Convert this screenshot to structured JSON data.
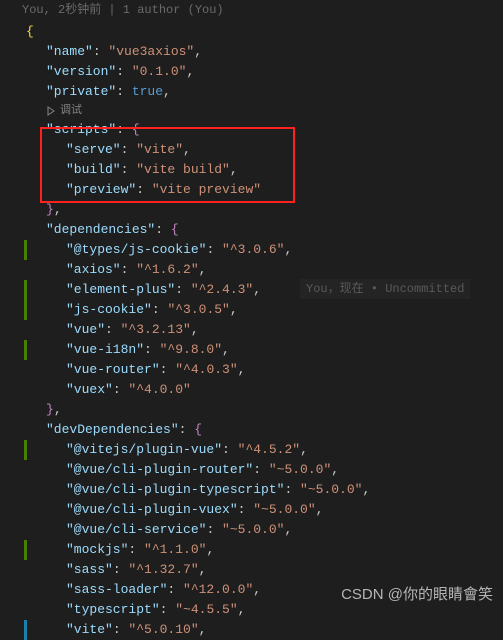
{
  "blame_top": "You, 2秒钟前 | 1 author (You)",
  "codelens_debug": "调试",
  "inline_blame": "You，现在 • Uncommitted",
  "watermark": "CSDN @你的眼睛會笑",
  "json": {
    "name_key": "\"name\"",
    "name_val": "\"vue3axios\"",
    "version_key": "\"version\"",
    "version_val": "\"0.1.0\"",
    "private_key": "\"private\"",
    "private_val": "true",
    "scripts_key": "\"scripts\"",
    "scripts": {
      "serve_key": "\"serve\"",
      "serve_val": "\"vite\"",
      "build_key": "\"build\"",
      "build_val": "\"vite build\"",
      "preview_key": "\"preview\"",
      "preview_val": "\"vite preview\""
    },
    "dependencies_key": "\"dependencies\"",
    "deps": {
      "types_jscookie_key": "\"@types/js-cookie\"",
      "types_jscookie_val": "\"^3.0.6\"",
      "axios_key": "\"axios\"",
      "axios_val": "\"^1.6.2\"",
      "element_plus_key": "\"element-plus\"",
      "element_plus_val": "\"^2.4.3\"",
      "js_cookie_key": "\"js-cookie\"",
      "js_cookie_val": "\"^3.0.5\"",
      "vue_key": "\"vue\"",
      "vue_val": "\"^3.2.13\"",
      "vue_i18n_key": "\"vue-i18n\"",
      "vue_i18n_val": "\"^9.8.0\"",
      "vue_router_key": "\"vue-router\"",
      "vue_router_val": "\"^4.0.3\"",
      "vuex_key": "\"vuex\"",
      "vuex_val": "\"^4.0.0\""
    },
    "devDependencies_key": "\"devDependencies\"",
    "devdeps": {
      "vitejs_plugin_vue_key": "\"@vitejs/plugin-vue\"",
      "vitejs_plugin_vue_val": "\"^4.5.2\"",
      "cli_router_key": "\"@vue/cli-plugin-router\"",
      "cli_router_val": "\"~5.0.0\"",
      "cli_typescript_key": "\"@vue/cli-plugin-typescript\"",
      "cli_typescript_val": "\"~5.0.0\"",
      "cli_vuex_key": "\"@vue/cli-plugin-vuex\"",
      "cli_vuex_val": "\"~5.0.0\"",
      "cli_service_key": "\"@vue/cli-service\"",
      "cli_service_val": "\"~5.0.0\"",
      "mockjs_key": "\"mockjs\"",
      "mockjs_val": "\"^1.1.0\"",
      "sass_key": "\"sass\"",
      "sass_val": "\"^1.32.7\"",
      "sass_loader_key": "\"sass-loader\"",
      "sass_loader_val": "\"^12.0.0\"",
      "typescript_key": "\"typescript\"",
      "typescript_val": "\"~4.5.5\"",
      "vite_key": "\"vite\"",
      "vite_val": "\"^5.0.10\""
    }
  }
}
